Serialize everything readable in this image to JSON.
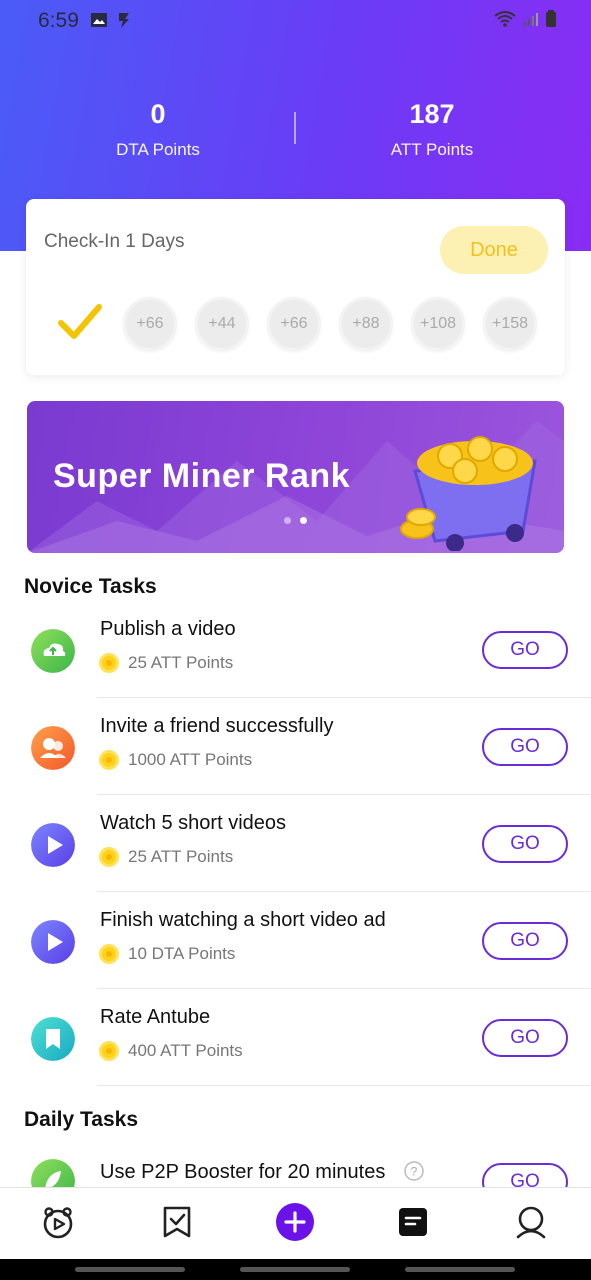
{
  "status_bar": {
    "time": "6:59"
  },
  "points": {
    "dta_value": "0",
    "dta_label": "DTA Points",
    "att_value": "187",
    "att_label": "ATT Points"
  },
  "checkin": {
    "title": "Check-In 1 Days",
    "done_label": "Done",
    "days": [
      "+66",
      "+44",
      "+66",
      "+88",
      "+108",
      "+158"
    ]
  },
  "banner": {
    "title": "Super Miner Rank",
    "active_slide": 2,
    "slide_count": 2
  },
  "novice_tasks": {
    "title": "Novice Tasks",
    "items": [
      {
        "name": "Publish a video",
        "reward": "25 ATT Points",
        "button": "GO"
      },
      {
        "name": "Invite a friend successfully",
        "reward": "1000 ATT Points",
        "button": "GO"
      },
      {
        "name": "Watch 5 short videos",
        "reward": "25 ATT Points",
        "button": "GO"
      },
      {
        "name": "Finish watching a short video ad",
        "reward": "10 DTA Points",
        "button": "GO"
      },
      {
        "name": "Rate Antube",
        "reward": "400 ATT Points",
        "button": "GO"
      }
    ]
  },
  "daily_tasks": {
    "title": "Daily Tasks",
    "items": [
      {
        "name": "Use P2P Booster for 20 minutes",
        "button": "GO"
      }
    ]
  },
  "colors": {
    "accent": "#6a2bd9",
    "header_start": "#4a5cf7",
    "header_end": "#8a2cf3",
    "done_bg": "#fdf0b3",
    "done_text": "#f3c11b",
    "coin": "#ffd21a"
  },
  "bottom_nav": {
    "items": [
      "home-icon",
      "tasks-icon",
      "add-icon",
      "points-icon",
      "profile-icon"
    ]
  }
}
